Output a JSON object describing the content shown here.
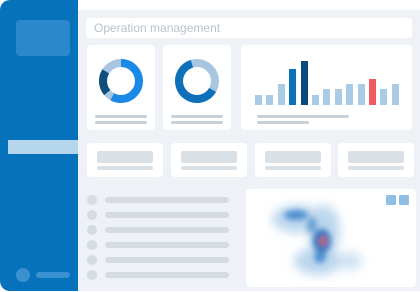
{
  "header": {
    "search_placeholder": "Operation management"
  },
  "donuts": [
    {
      "name": "donut-chart-left",
      "fraction": 0.78,
      "main_color": "#1a8ae6",
      "dark_color": "#0e4f7e",
      "track_color": "#a9c6e0"
    },
    {
      "name": "donut-chart-right",
      "fraction": 0.62,
      "main_color": "#0e70b8",
      "dark_color": "#0a5a97",
      "track_color": "#a9c6e0"
    }
  ],
  "bar_chart": {
    "values": [
      2,
      2,
      4,
      7,
      8.5,
      2,
      3,
      3,
      4,
      4,
      5,
      3,
      4
    ],
    "highlight": {
      "3": "#0e70b8",
      "4": "#0a4c7f",
      "10": "#ef5a63"
    },
    "base_color": "#a9cbe6"
  },
  "colors": {
    "sidebar": "#0572bb",
    "accent_red": "#ef5a63"
  }
}
